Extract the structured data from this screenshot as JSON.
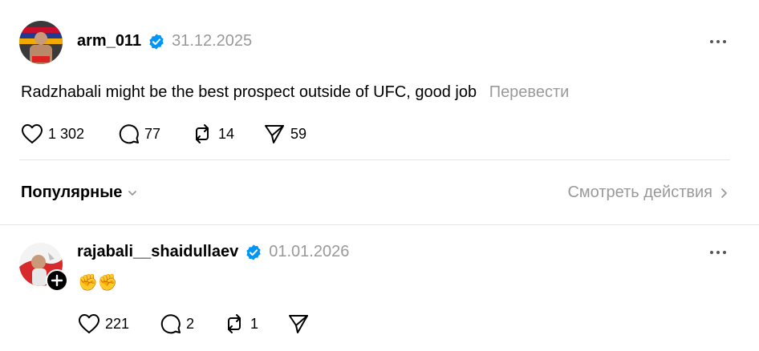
{
  "post": {
    "username": "arm_011",
    "date": "31.12.2025",
    "text": "Radzhabali might be the best prospect outside of UFC, good job",
    "translate_label": "Перевести",
    "likes": "1 302",
    "comments": "77",
    "reposts": "14",
    "shares": "59"
  },
  "activity": {
    "popular_label": "Популярные",
    "view_activity_label": "Смотреть действия"
  },
  "reply": {
    "username": "rajabali__shaidullaev",
    "date": "01.01.2026",
    "text": "✊✊",
    "likes": "221",
    "comments": "2",
    "reposts": "1"
  },
  "colors": {
    "verified": "#0095f6",
    "muted_text": "#999999",
    "divider": "#e5e5e5"
  },
  "icons": [
    "heart-icon",
    "comment-icon",
    "repost-icon",
    "share-icon",
    "verified-icon",
    "more-icon",
    "chevron-down-icon",
    "chevron-right-icon",
    "plus-icon"
  ]
}
